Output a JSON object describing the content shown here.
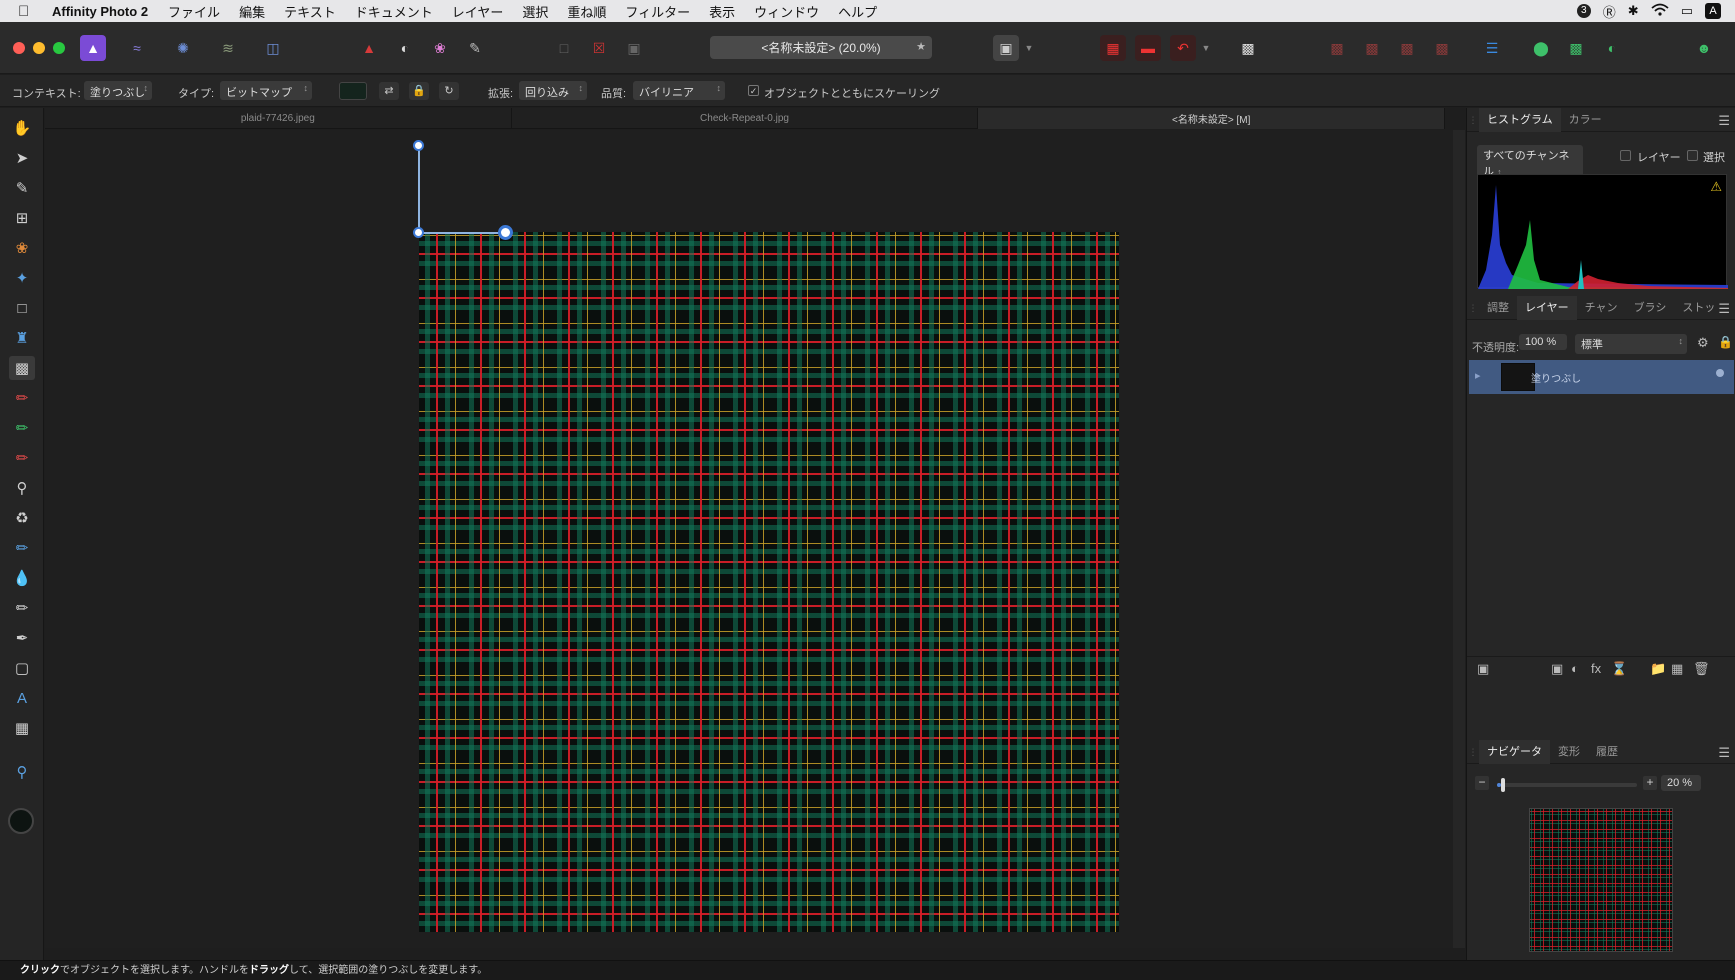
{
  "menubar": {
    "app_name": "Affinity Photo 2",
    "items": [
      "ファイル",
      "編集",
      "テキスト",
      "ドキュメント",
      "レイヤー",
      "選択",
      "重ね順",
      "フィルター",
      "表示",
      "ウィンドウ",
      "ヘルプ"
    ],
    "status_icons": [
      "badge-3-icon",
      "copyright-icon",
      "bluetooth-icon",
      "wifi-icon",
      "airplay-icon",
      "input-source-icon"
    ],
    "input_badge": "A",
    "status_number": "3"
  },
  "toolbar": {
    "document_title": "<名称未設定> (20.0%)"
  },
  "context_bar": {
    "context_label": "コンテキスト:",
    "context_value": "塗りつぶし",
    "type_label": "タイプ:",
    "type_value": "ビットマップ",
    "extend_label": "拡張:",
    "extend_value": "回り込み",
    "quality_label": "品質:",
    "quality_value": "バイリニア",
    "scale_with_object_label": "オブジェクトとともにスケーリング",
    "scale_with_object_checked": true
  },
  "tabs": [
    {
      "label": "plaid-77426.jpeg",
      "active": false
    },
    {
      "label": "Check-Repeat-0.jpg",
      "active": false
    },
    {
      "label": "<名称未設定> [M]",
      "active": true
    }
  ],
  "histogram_panel": {
    "tabs": [
      "ヒストグラム",
      "カラー"
    ],
    "channel_select": "すべてのチャンネル",
    "layer_label": "レイヤー",
    "selection_label": "選択",
    "warning_icon": "warning-icon"
  },
  "layers_panel": {
    "tabs": [
      "調整",
      "レイヤー",
      "チャン",
      "ブラシ",
      "ストッ"
    ],
    "opacity_label": "不透明度:",
    "opacity_value": "100 %",
    "blend_mode": "標準",
    "layer_name": "塗りつぶし"
  },
  "navigator_panel": {
    "tabs": [
      "ナビゲータ",
      "変形",
      "履歴"
    ],
    "zoom_value": "20 %",
    "zoom_level": 0.2
  },
  "status_bar": {
    "click_word": "クリック",
    "text1": "でオブジェクトを選択します。ハンドルを",
    "drag_word": "ドラッグ",
    "text2": "して、選択範囲の塗りつぶしを変更します。"
  }
}
